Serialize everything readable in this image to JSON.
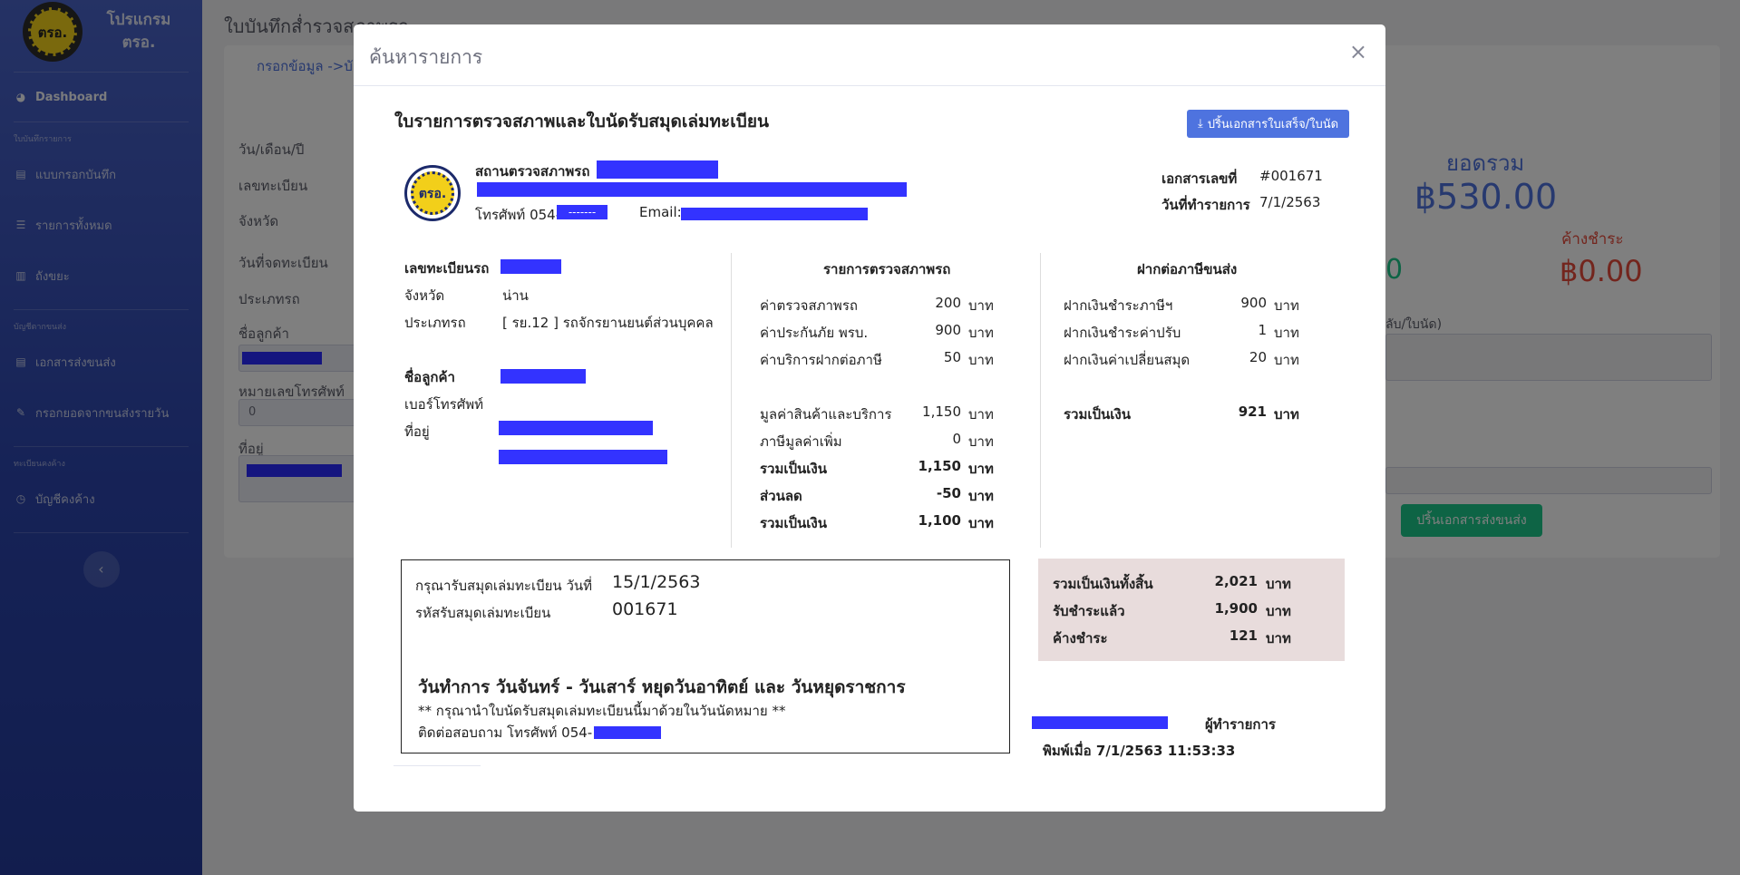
{
  "sidebar": {
    "brand_line1": "โปรแกรม",
    "brand_line2": "ตรอ.",
    "logo_text": "ตรอ.",
    "dashboard": "Dashboard",
    "section_record": "ใบบันทึกรายการ",
    "item_form": "แบบกรอกบันทึก",
    "item_all": "รายการทั้งหมด",
    "item_trash": "ถังขยะ",
    "section_transport": "บัญชีตากขนส่ง",
    "item_transport_docs": "เอกสารส่งขนส่ง",
    "item_daily": "กรอกยอดจากขนส่งรายวัน",
    "section_debt": "ทะเบียนคงค้าง",
    "item_debt": "บัญชีคงค้าง",
    "toggle": "‹"
  },
  "background": {
    "page_title": "ใบบันทึกส่ำรวจสภาพรถ",
    "breadcrumb": "กรอกข้อมูล ->บั",
    "label_date": "วัน/เดือน/ปี",
    "label_plate": "เลขทะเบียน",
    "label_province": "จังหวัด",
    "label_reg_date": "วันที่จดทะเบียน",
    "label_type": "ประเภทรถ",
    "label_customer": "ชื่อลูกค้า",
    "label_phone": "หมายเลขโทรศัพท์",
    "phone_value": "0",
    "label_address": "ที่อยู่",
    "total_title": "ยอดรวม",
    "total_amount": "฿530.00",
    "zero_fragment": "0",
    "outstanding_title": "ค้างชำระ",
    "outstanding_amount": "฿0.00",
    "note_fragment": "ลับ/ใบนัด)",
    "print_transport_button": "ปริ้นเอกสารส่งขนส่ง"
  },
  "modal": {
    "title": "ค้นหารายการ",
    "close": "×",
    "doc_title": "ใบรายการตรวจสภาพและใบนัดรับสมุดเล่มทะเบียน",
    "print_button": "ปริ้นเอกสารใบเสร็จ/ใบนัด",
    "print_icon": "⤓",
    "station": {
      "logo_text": "ตรอ.",
      "name_label": "สถานตรวจสภาพรถ",
      "phone_label": "โทรศัพท์ 054-",
      "phone_masked": "-------",
      "email_label": "Email:"
    },
    "doc_no_label": "เอกสารเลขที่",
    "doc_no": "#001671",
    "doc_date_label": "วันที่ทำรายการ",
    "doc_date": "7/1/2563",
    "vehicle": {
      "plate_label": "เลขทะเบียนรถ",
      "province_label": "จังหวัด",
      "province": "น่าน",
      "type_label": "ประเภทรถ",
      "type": "[ รย.12 ] รถจักรยานยนต์ส่วนบุคคล",
      "customer_label": "ชื่อลูกค้า",
      "phone_label": "เบอร์โทรศัพท์",
      "address_label": "ที่อยู่"
    },
    "inspection": {
      "heading": "รายการตรวจสภาพรถ",
      "items": [
        {
          "label": "ค่าตรวจสภาพรถ",
          "amount": "200",
          "unit": "บาท"
        },
        {
          "label": "ค่าประกันภัย พรบ.",
          "amount": "900",
          "unit": "บาท"
        },
        {
          "label": "ค่าบริการฝากต่อภาษี",
          "amount": "50",
          "unit": "บาท"
        }
      ],
      "subtotal_label": "มูลค่าสินค้าและบริการ",
      "subtotal": "1,150",
      "subtotal_unit": "บาท",
      "vat_label": "ภาษีมูลค่าเพิ่ม",
      "vat": "0",
      "vat_unit": "บาท",
      "total1_label": "รวมเป็นเงิน",
      "total1": "1,150",
      "total1_unit": "บาท",
      "discount_label": "ส่วนลด",
      "discount": "-50",
      "discount_unit": "บาท",
      "total2_label": "รวมเป็นเงิน",
      "total2": "1,100",
      "total2_unit": "บาท"
    },
    "tax": {
      "heading": "ฝากต่อภาษีขนส่ง",
      "items": [
        {
          "label": "ฝากเงินชำระภาษีฯ",
          "amount": "900",
          "unit": "บาท"
        },
        {
          "label": "ฝากเงินชำระค่าปรับ",
          "amount": "1",
          "unit": "บาท"
        },
        {
          "label": "ฝากเงินค่าเปลี่ยนสมุด",
          "amount": "20",
          "unit": "บาท"
        }
      ],
      "total_label": "รวมเป็นเงิน",
      "total": "921",
      "total_unit": "บาท"
    },
    "appointment": {
      "date_label": "กรุณารับสมุดเล่มทะเบียน วันที่",
      "date": "15/1/2563",
      "code_label": "รหัสรับสมุดเล่มทะเบียน",
      "code": "001671",
      "hours": "วันทำการ วันจันทร์ - วันเสาร์ หยุดวันอาทิตย์ และ วันหยุดราชการ",
      "note": "** กรุณานำใบนัดรับสมุดเล่มทะเบียนนี้มาด้วยในวันนัดหมาย **",
      "contact": "ติดต่อสอบถาม โทรศัพท์ 054-"
    },
    "summary": {
      "grand_label": "รวมเป็นเงินทั้งสิ้น",
      "grand": "2,021",
      "grand_unit": "บาท",
      "paid_label": "รับชำระแล้ว",
      "paid": "1,900",
      "paid_unit": "บาท",
      "due_label": "ค้างชำระ",
      "due": "121",
      "due_unit": "บาท"
    },
    "operator_label": "ผู้ทำรายการ",
    "printed_at": "พิมพ์เมื่อ 7/1/2563 11:53:33"
  },
  "colors": {
    "sidebar": "#2c45ad",
    "primary": "#4e73df",
    "success": "#1cc88a",
    "danger": "#e74a3b",
    "redaction": "#3333ff",
    "summary_bg": "#e8dcdc"
  }
}
